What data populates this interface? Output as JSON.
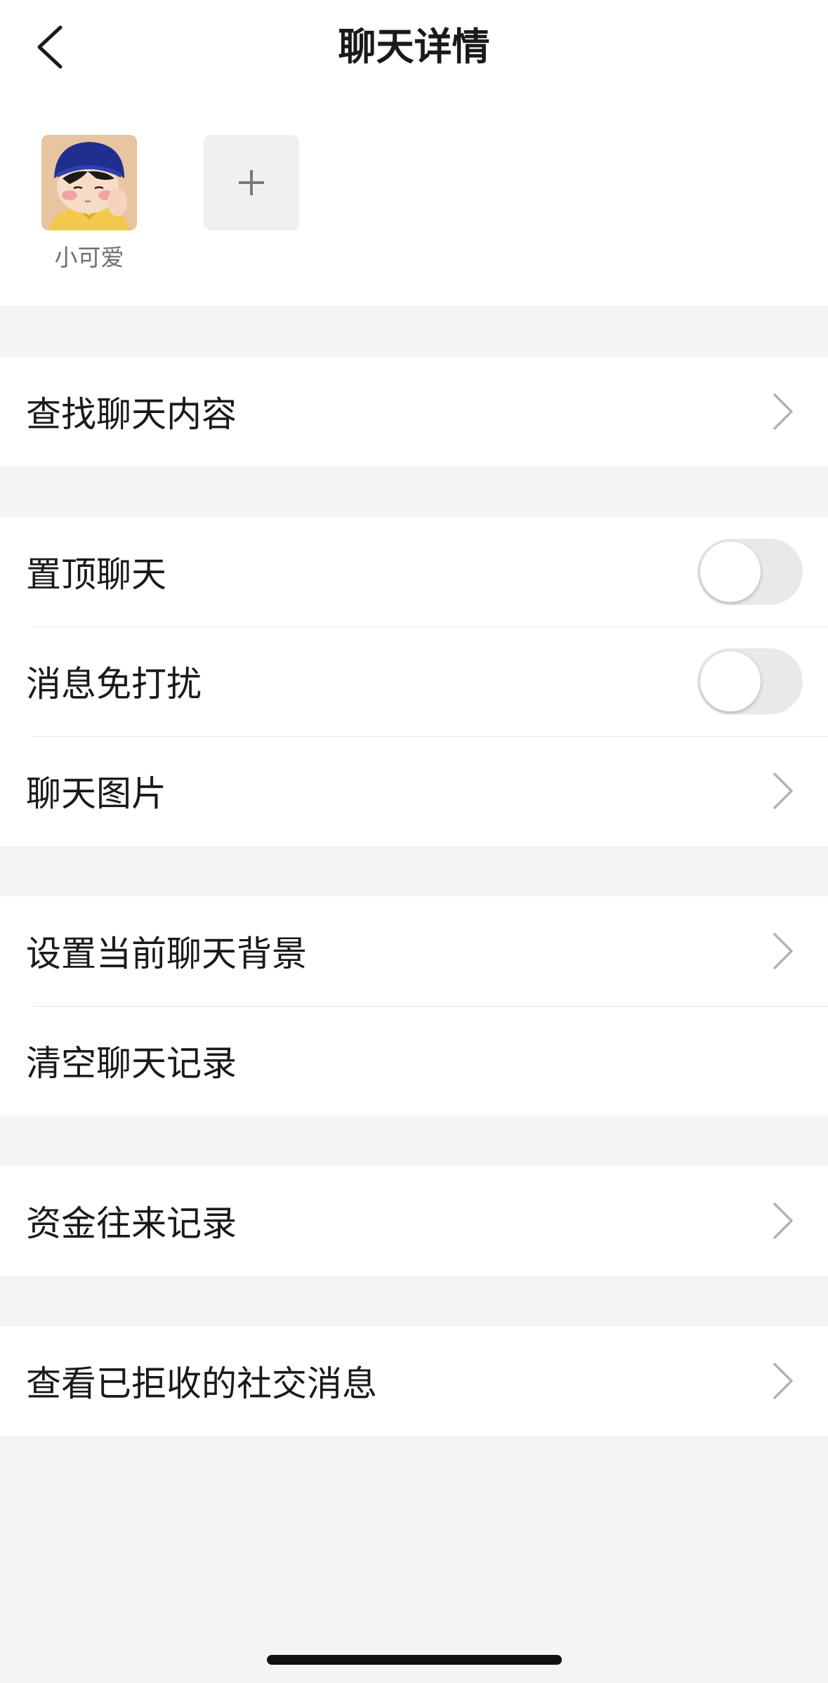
{
  "header": {
    "title": "聊天详情",
    "back_icon": "chevron-left-icon"
  },
  "members": {
    "items": [
      {
        "name": "小可爱",
        "avatar": "cartoon-girl-avatar"
      }
    ],
    "add_icon": "plus-icon"
  },
  "groups": {
    "search": {
      "label": "查找聊天内容"
    },
    "chat_settings": {
      "pin": {
        "label": "置顶聊天",
        "toggle": false
      },
      "mute": {
        "label": "消息免打扰",
        "toggle": false
      },
      "images": {
        "label": "聊天图片"
      }
    },
    "background": {
      "set_background": {
        "label": "设置当前聊天背景"
      },
      "clear_history": {
        "label": "清空聊天记录"
      }
    },
    "funds": {
      "label": "资金往来记录"
    },
    "rejected": {
      "label": "查看已拒收的社交消息"
    }
  },
  "colors": {
    "background": "#f4f4f4",
    "card": "#ffffff",
    "toggle_off": "#e9e9e9",
    "chevron": "#b2b2b2"
  }
}
